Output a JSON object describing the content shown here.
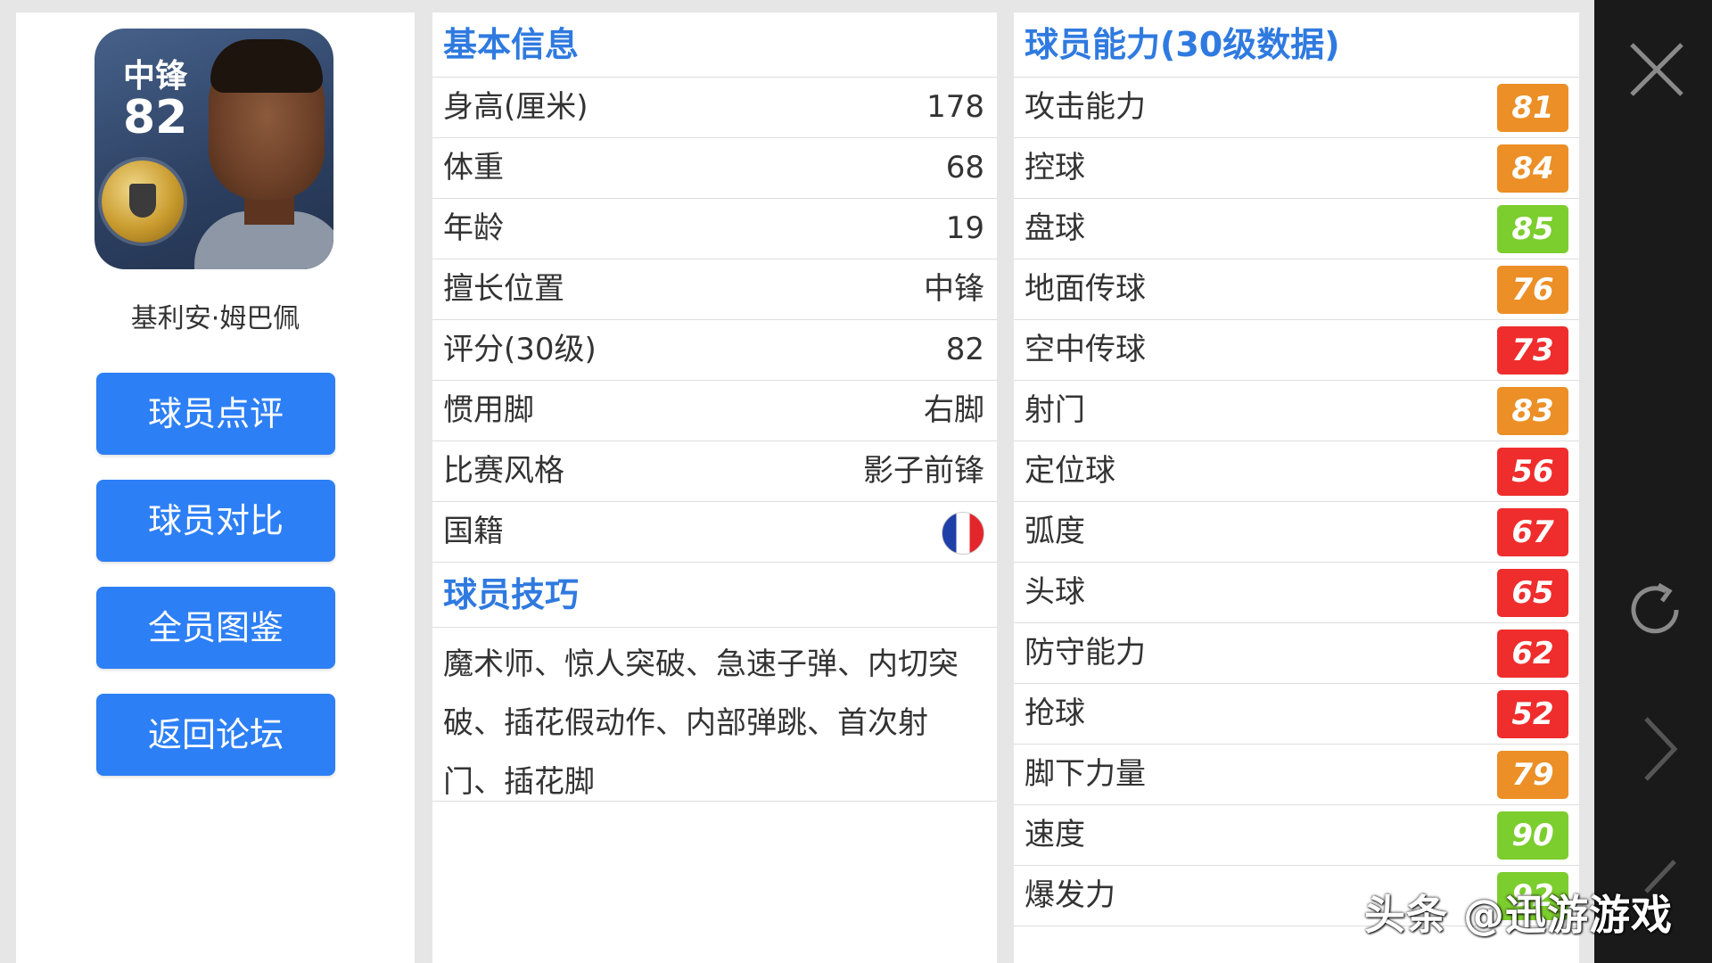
{
  "player": {
    "position": "中锋",
    "rating": "82",
    "name": "基利安·姆巴佩"
  },
  "buttons": [
    "球员点评",
    "球员对比",
    "全员图鉴",
    "返回论坛"
  ],
  "basic_info": {
    "title": "基本信息",
    "rows": [
      {
        "label": "身高(厘米)",
        "value": "178"
      },
      {
        "label": "体重",
        "value": "68"
      },
      {
        "label": "年龄",
        "value": "19"
      },
      {
        "label": "擅长位置",
        "value": "中锋"
      },
      {
        "label": "评分(30级)",
        "value": "82"
      },
      {
        "label": "惯用脚",
        "value": "右脚"
      },
      {
        "label": "比赛风格",
        "value": "影子前锋"
      },
      {
        "label": "国籍",
        "value": ""
      }
    ],
    "nationality_flag": "france-flag-icon"
  },
  "skills": {
    "title": "球员技巧",
    "text": "魔术师、惊人突破、急速子弹、内切突破、插花假动作、内部弹跳、首次射门、插花脚"
  },
  "abilities": {
    "title": "球员能力(30级数据)",
    "rows": [
      {
        "label": "攻击能力",
        "value": "81",
        "color": "#eb8f26"
      },
      {
        "label": "控球",
        "value": "84",
        "color": "#eb8f26"
      },
      {
        "label": "盘球",
        "value": "85",
        "color": "#7ccd2e"
      },
      {
        "label": "地面传球",
        "value": "76",
        "color": "#eb8f26"
      },
      {
        "label": "空中传球",
        "value": "73",
        "color": "#ef2d2d"
      },
      {
        "label": "射门",
        "value": "83",
        "color": "#eb8f26"
      },
      {
        "label": "定位球",
        "value": "56",
        "color": "#ef2d2d"
      },
      {
        "label": "弧度",
        "value": "67",
        "color": "#ef2d2d"
      },
      {
        "label": "头球",
        "value": "65",
        "color": "#ef2d2d"
      },
      {
        "label": "防守能力",
        "value": "62",
        "color": "#ef2d2d"
      },
      {
        "label": "抢球",
        "value": "52",
        "color": "#ef2d2d"
      },
      {
        "label": "脚下力量",
        "value": "79",
        "color": "#eb8f26"
      },
      {
        "label": "速度",
        "value": "90",
        "color": "#7ccd2e"
      },
      {
        "label": "爆发力",
        "value": "92",
        "color": "#7ccd2e"
      }
    ]
  },
  "rail_icons": [
    "close-icon",
    "refresh-icon",
    "next-arrow-icon",
    "back-arrow-icon"
  ],
  "watermark": "头条 @迅游游戏"
}
